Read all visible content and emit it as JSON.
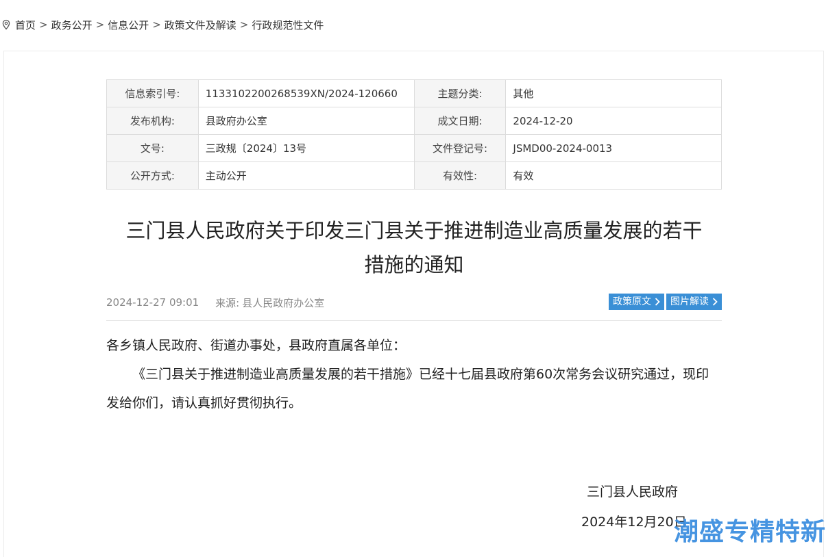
{
  "breadcrumb": {
    "items": [
      "首页",
      "政务公开",
      "信息公开",
      "政策文件及解读",
      "行政规范性文件"
    ],
    "separator": ">"
  },
  "meta": {
    "rows": [
      {
        "l1": "信息索引号:",
        "v1": "113310220026853​9XN/2024-120660",
        "l2": "主题分类:",
        "v2": "其他"
      },
      {
        "l1": "发布机构:",
        "v1": "县政府办公室",
        "l2": "成文日期:",
        "v2": "2024-12-20"
      },
      {
        "l1": "文号:",
        "v1": "三政规〔2024〕13号",
        "l2": "文件登记号:",
        "v2": "JSMD00-2024-0013"
      },
      {
        "l1": "公开方式:",
        "v1": "主动公开",
        "l2": "有效性:",
        "v2": "有效"
      }
    ]
  },
  "document": {
    "title_line1": "三门县人民政府关于印发三门县关于推进制造业高质量发展的若干",
    "title_line2": "措施的通知",
    "publish_time": "2024-12-27 09:01",
    "source_label": "来源:",
    "source": "县人民政府办公室",
    "btn_original": "政策原文",
    "btn_image": "图片解读",
    "salutation": "各乡镇人民政府、街道办事处，县政府直属各单位：",
    "paragraph": "《三门县关于推进制造业高质量发展的若干措施》已经十七届县政府第60次常务会议研究通过，现印发给你们，请认真抓好贯彻执行。",
    "signature_org": "三门县人民政府",
    "signature_date": "2024年12月20日"
  },
  "watermark": "潮盛专精特新",
  "colors": {
    "accent": "#3a8fd6",
    "watermark": "#3d8fe0"
  }
}
